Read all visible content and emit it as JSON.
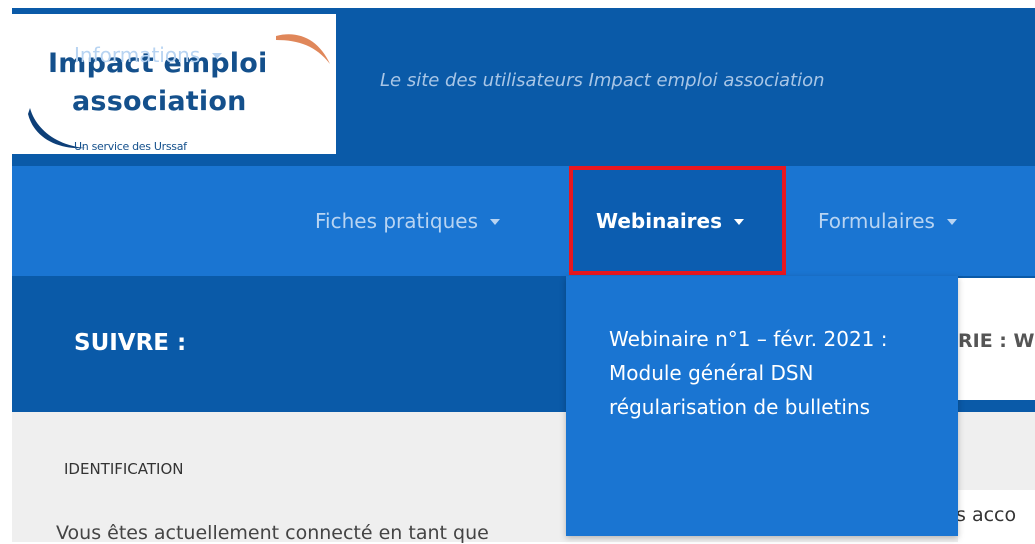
{
  "header": {
    "logo": {
      "line1": "Impact emploi",
      "line2": "association",
      "subtitle": "Un service des Urssaf"
    },
    "tagline": "Le site des utilisateurs Impact emploi association"
  },
  "nav": {
    "items": [
      {
        "label": "Informations"
      },
      {
        "label": "Fiches pratiques"
      },
      {
        "label": "Webinaires",
        "active": true
      },
      {
        "label": "Formulaires"
      }
    ]
  },
  "dropdown": {
    "items": [
      {
        "label": "Webinaire n°1 – févr. 2021 : Module général DSN régularisation de bulletins"
      }
    ]
  },
  "main": {
    "suivre_label": "SUIVRE :",
    "category_label": "RIE : W",
    "identification_title": "IDENTIFICATION",
    "identification_text": "Vous êtes actuellement connecté en tant que",
    "right_snippet": "s acco"
  },
  "colors": {
    "header_bg": "#0a5aa8",
    "nav_bg": "#1a75d2",
    "highlight_border": "#e8171f",
    "swoosh_accent": "#e0875a"
  }
}
